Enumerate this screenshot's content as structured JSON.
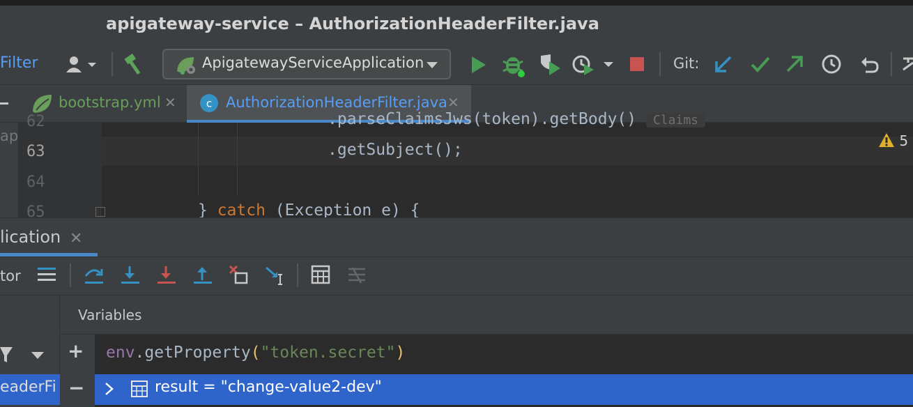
{
  "window": {
    "title": "apigateway-service – AuthorizationHeaderFilter.java"
  },
  "toolbar": {
    "breadcrumb": "Filter",
    "run_config": "ApigatewayServiceApplication",
    "git_label": "Git:",
    "icons": [
      "user-icon",
      "build-hammer-icon",
      "run-icon",
      "debug-icon",
      "coverage-icon",
      "profile-icon",
      "stop-icon",
      "git-update-icon",
      "git-commit-icon",
      "git-push-icon",
      "history-icon",
      "rollback-icon"
    ]
  },
  "tabs": [
    {
      "label": "bootstrap.yml",
      "icon": "spring-leaf-icon",
      "active": false
    },
    {
      "label": "AuthorizationHeaderFilter.java",
      "icon": "class-c-icon",
      "active": true
    }
  ],
  "editor": {
    "left_truncated": "api",
    "lines": [
      {
        "num": "62",
        "code": ".parseClaimsJws(token).getBody()",
        "hint": "Claims"
      },
      {
        "num": "63",
        "code": ".getSubject();"
      },
      {
        "num": "64",
        "code": ""
      },
      {
        "num": "65",
        "code_prefix": "} ",
        "keyword": "catch",
        "code_suffix": " (Exception e) {"
      }
    ],
    "warning_count": "5"
  },
  "debug": {
    "tab_label": "lication",
    "debugger_tab": "tor",
    "variables_title": "Variables",
    "expression": {
      "object": "env",
      "method": ".getProperty",
      "open": "(",
      "arg": "\"token.secret\"",
      "close": ")"
    },
    "result": "result = \"change-value2-dev\"",
    "frame_label": "eaderFi",
    "add_symbol": "+",
    "remove_symbol": "−"
  },
  "colors": {
    "accent": "#4a88c7",
    "selection": "#2f65ca",
    "run_green": "#499c54",
    "stop_red": "#c75450"
  }
}
